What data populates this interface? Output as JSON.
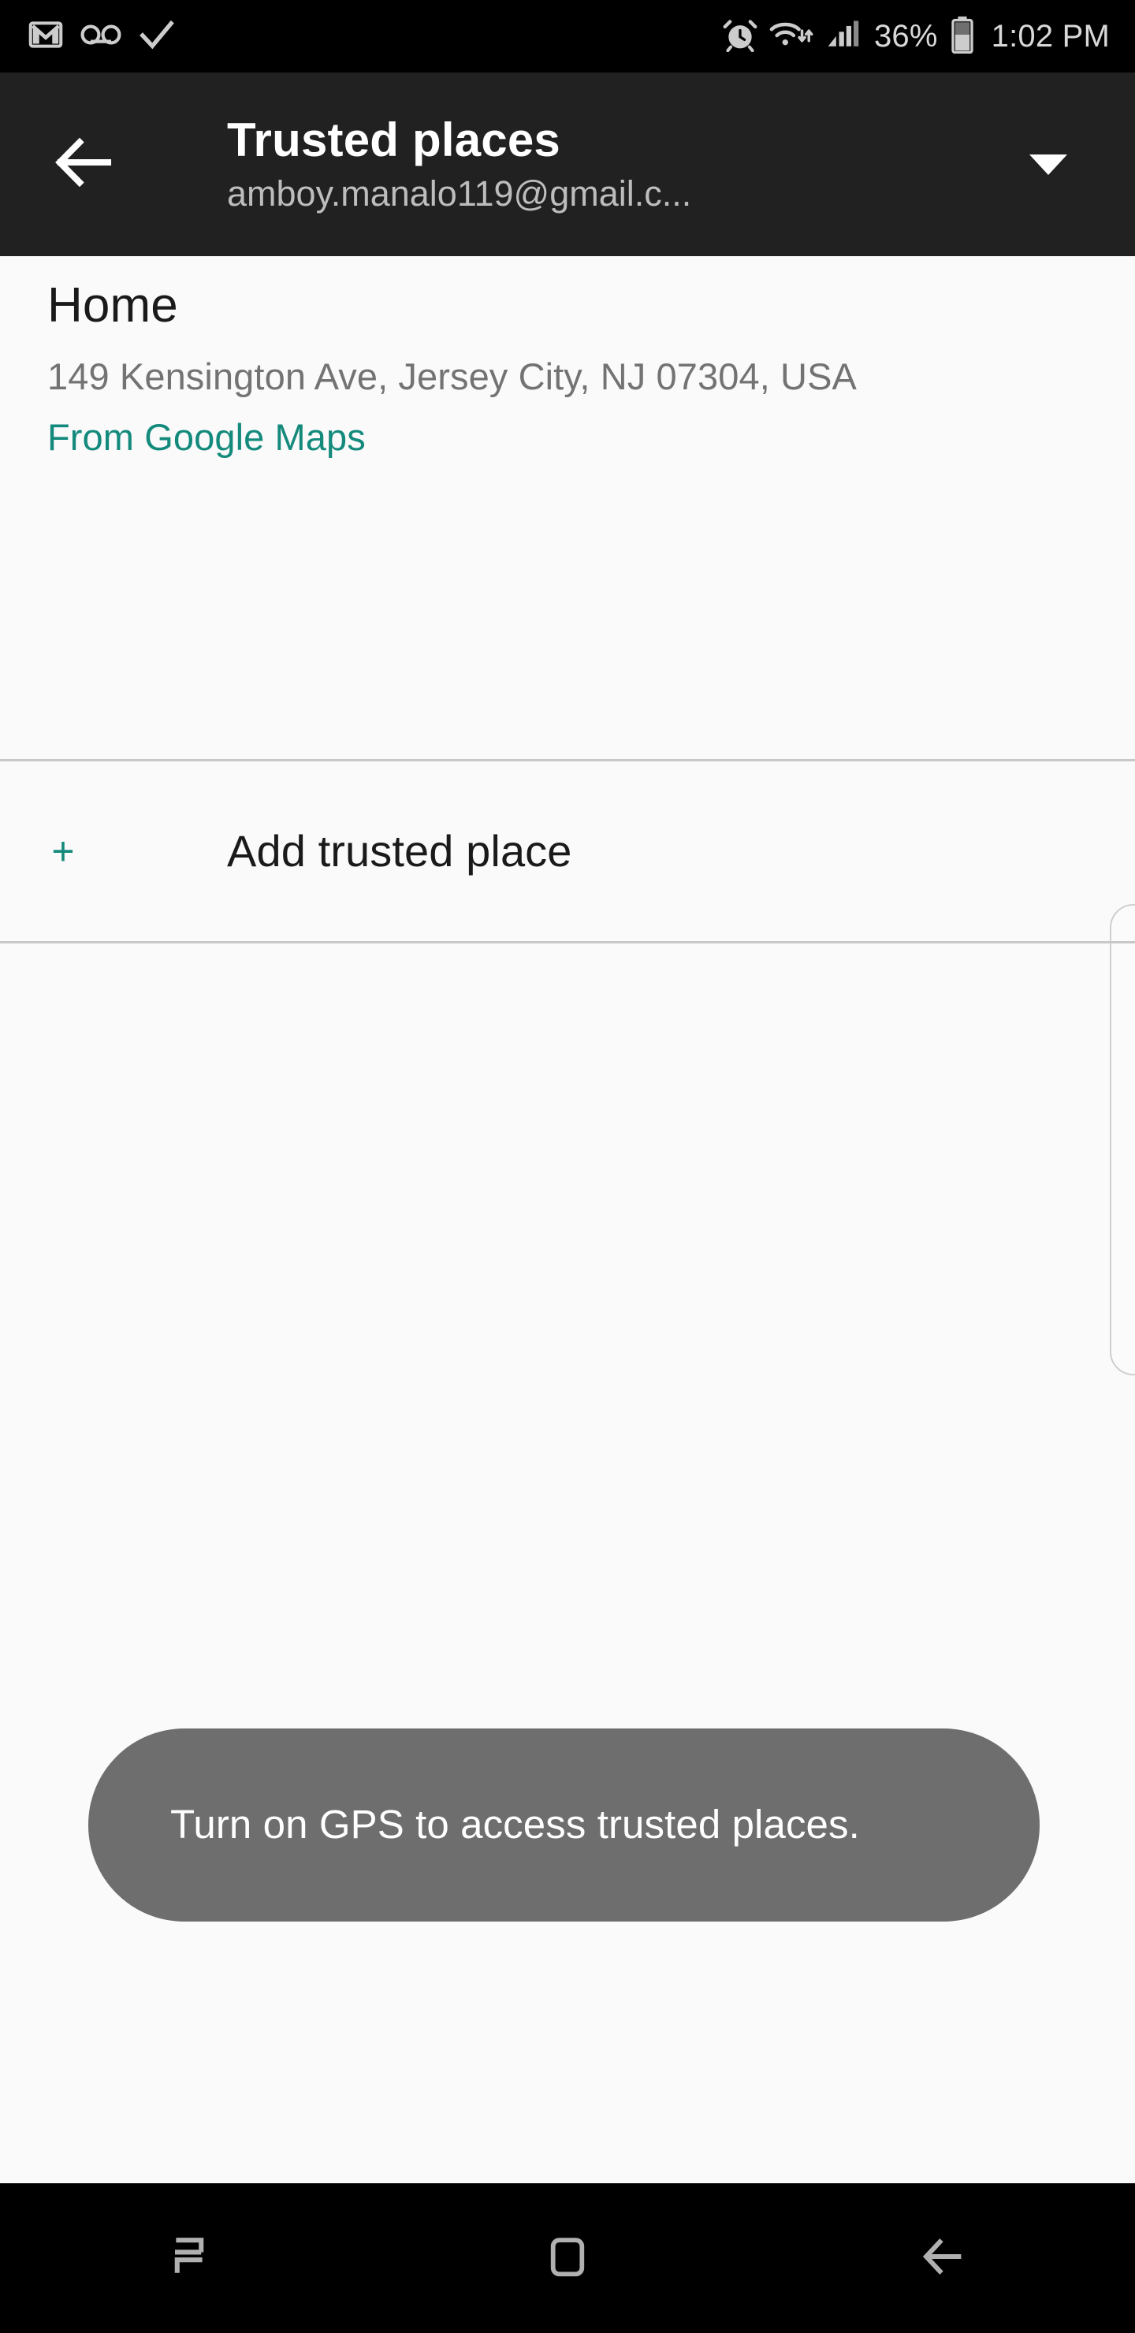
{
  "status_bar": {
    "left_icons": [
      {
        "name": "gmail-icon",
        "label": "Gmail"
      },
      {
        "name": "voicemail-icon",
        "label": "Voicemail"
      },
      {
        "name": "checkmark-icon",
        "label": "Check"
      }
    ],
    "right_icons": [
      {
        "name": "alarm-icon",
        "label": "Alarm"
      },
      {
        "name": "wifi-icon",
        "label": "Wi-Fi"
      },
      {
        "name": "signal-icon",
        "label": "Signal"
      }
    ],
    "battery_percent": "36%",
    "battery_icon": "battery-icon",
    "time": "1:02 PM"
  },
  "app_bar": {
    "back_icon": "arrow-left-icon",
    "title": "Trusted places",
    "subtitle": "amboy.manalo119@gmail.c...",
    "dropdown_icon": "caret-down-icon"
  },
  "content": {
    "place": {
      "name": "Home",
      "address": "149 Kensington Ave, Jersey City, NJ 07304, USA",
      "source": "From Google Maps"
    },
    "add_place": {
      "icon": "plus-icon",
      "icon_glyph": "+",
      "label": "Add trusted place"
    }
  },
  "toast": {
    "message": "Turn on GPS to access trusted places."
  },
  "nav_bar": {
    "recents_icon": "recents-icon",
    "home_icon": "home-square-icon",
    "back_icon": "nav-back-icon"
  },
  "colors": {
    "status_bar_bg": "#000000",
    "app_bar_bg": "#212121",
    "content_bg": "#fafafa",
    "accent_teal": "#138a7c",
    "toast_bg": "#6e6e6e",
    "divider": "#c8c8c8",
    "secondary_text": "#737373"
  }
}
